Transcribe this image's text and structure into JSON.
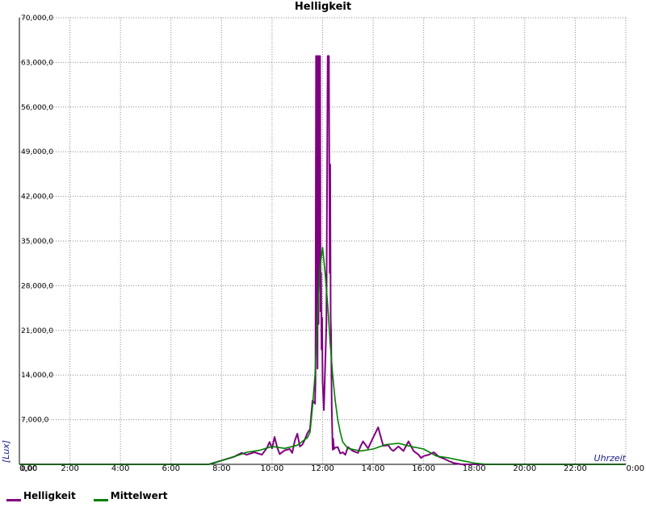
{
  "chart_data": {
    "type": "line",
    "title": "Helligkeit",
    "ylabel": "[Lux]",
    "xlabel": "Uhrzeit",
    "ylim": [
      0,
      70000
    ],
    "xlim": [
      0,
      24
    ],
    "grid": true,
    "legend_placement": "bottom-left",
    "y_ticks": [
      "0,00",
      "7,000,0",
      "14,000,0",
      "21,000,0",
      "28,000,0",
      "35,000,0",
      "42,000,0",
      "49,000,0",
      "56,000,0",
      "63,000,0",
      "70,000,0"
    ],
    "y_tick_values": [
      0,
      7000,
      14000,
      21000,
      28000,
      35000,
      42000,
      49000,
      56000,
      63000,
      70000
    ],
    "x_ticks": [
      "0,00",
      "2:00",
      "4:00",
      "6:00",
      "8:00",
      "10:00",
      "12:00",
      "14:00",
      "16:00",
      "18:00",
      "20:00",
      "22:00",
      "0:00"
    ],
    "x_tick_values": [
      0,
      2,
      4,
      6,
      8,
      10,
      12,
      14,
      16,
      18,
      20,
      22,
      24
    ],
    "series": [
      {
        "name": "Helligkeit",
        "color": "#800080",
        "x": [
          0,
          7.5,
          8,
          8.5,
          8.8,
          9,
          9.3,
          9.6,
          9.8,
          9.9,
          10,
          10.1,
          10.2,
          10.3,
          10.5,
          10.7,
          10.8,
          10.9,
          11,
          11.1,
          11.2,
          11.3,
          11.4,
          11.5,
          11.6,
          11.7,
          11.72,
          11.74,
          11.76,
          11.78,
          11.8,
          11.82,
          11.84,
          11.86,
          11.88,
          11.9,
          11.92,
          11.94,
          11.96,
          11.98,
          12.0,
          12.05,
          12.1,
          12.15,
          12.2,
          12.25,
          12.28,
          12.3,
          12.32,
          12.34,
          12.36,
          12.38,
          12.4,
          12.42,
          12.45,
          12.5,
          12.6,
          12.7,
          12.8,
          12.9,
          13,
          13.2,
          13.4,
          13.5,
          13.6,
          13.8,
          14,
          14.2,
          14.4,
          14.6,
          14.7,
          14.8,
          15,
          15.2,
          15.4,
          15.6,
          15.8,
          15.9,
          16,
          16.2,
          16.4,
          16.6,
          16.8,
          17,
          17.2,
          17.5,
          18,
          18.5,
          24
        ],
        "y": [
          0,
          0,
          600,
          1200,
          1800,
          1500,
          1900,
          1500,
          2600,
          3500,
          2500,
          4300,
          2700,
          1600,
          2200,
          2400,
          1800,
          3700,
          4800,
          2800,
          3100,
          3900,
          4900,
          5500,
          10000,
          9500,
          13000,
          64000,
          20000,
          64000,
          15000,
          64000,
          22000,
          64000,
          28000,
          64000,
          24000,
          30000,
          18000,
          23000,
          13000,
          8500,
          15000,
          22000,
          64000,
          64000,
          30000,
          47000,
          23000,
          20000,
          9000,
          5500,
          2300,
          4000,
          2400,
          2600,
          2700,
          1700,
          1900,
          1500,
          2700,
          2100,
          1800,
          2800,
          3600,
          2500,
          4200,
          5800,
          2900,
          3000,
          2400,
          2100,
          2800,
          2100,
          3600,
          2100,
          1500,
          1000,
          1300,
          1500,
          1900,
          1200,
          900,
          500,
          200,
          0,
          0,
          0,
          0
        ]
      },
      {
        "name": "Mittelwert",
        "color": "#008000",
        "x": [
          0,
          7.5,
          8,
          8.5,
          9,
          9.5,
          10,
          10.5,
          11,
          11.2,
          11.4,
          11.5,
          11.6,
          11.7,
          11.8,
          11.9,
          12.0,
          12.1,
          12.2,
          12.3,
          12.4,
          12.5,
          12.6,
          12.7,
          12.8,
          13,
          13.5,
          14,
          14.5,
          15,
          15.5,
          16,
          16.5,
          17,
          17.5,
          18,
          18.5,
          24
        ],
        "y": [
          0,
          0,
          600,
          1200,
          1900,
          2200,
          2800,
          2500,
          3000,
          3600,
          4200,
          5000,
          9000,
          14000,
          23000,
          31000,
          34000,
          30000,
          25000,
          19000,
          14000,
          10000,
          7000,
          5000,
          3500,
          2500,
          2100,
          2400,
          3100,
          3300,
          2800,
          2400,
          1300,
          1000,
          600,
          200,
          0,
          0
        ]
      }
    ]
  }
}
